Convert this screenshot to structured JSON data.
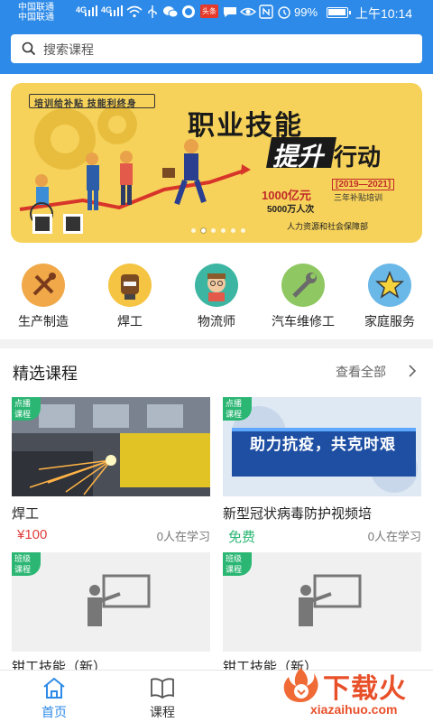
{
  "status_bar": {
    "carrier1": "中国联通",
    "carrier2": "中国联通",
    "net1": "4G",
    "net2": "4G",
    "notif_badge": "头条",
    "battery": "99%",
    "time": "上午10:14",
    "battery_level": 0.99
  },
  "search": {
    "placeholder": "搜索课程",
    "icon": "search-icon"
  },
  "banner": {
    "tag": "培训给补贴  技能利终身",
    "title1": "职业技能",
    "title2a": "提升",
    "title2b": "行动",
    "years": "[2019—2021]",
    "subtitle": "三年补贴培训",
    "amount": "1000亿元",
    "people": "5000万人次",
    "ministry": "人力资源和社会保障部",
    "slides": 6,
    "active_slide": 1
  },
  "categories": [
    {
      "label": "生产制造",
      "icon": "tools-icon",
      "color": "#f0a848"
    },
    {
      "label": "焊工",
      "icon": "welder-icon",
      "color": "#f5c443"
    },
    {
      "label": "物流师",
      "icon": "logistician-icon",
      "color": "#3cb6a2"
    },
    {
      "label": "汽车维修工",
      "icon": "wrench-icon",
      "color": "#8fc862"
    },
    {
      "label": "家庭服务",
      "icon": "star-icon",
      "color": "#6ab8e8"
    }
  ],
  "section": {
    "title": "精选课程",
    "see_all": "查看全部"
  },
  "courses": [
    {
      "badge": "点播课程",
      "title": "焊工",
      "price": "¥100",
      "learners": "0人在学习"
    },
    {
      "badge": "点播课程",
      "title": "新型冠状病毒防护视频培",
      "price": "免费",
      "learners": "0人在学习",
      "image_text": "助力抗疫，共克时艰"
    },
    {
      "badge": "班级课程",
      "title": "钳工技能（新）"
    },
    {
      "badge": "班级课程",
      "title": "钳工技能（新）"
    }
  ],
  "nav": [
    {
      "label": "首页",
      "icon": "home-icon",
      "active": true
    },
    {
      "label": "课程",
      "icon": "book-icon",
      "active": false
    }
  ],
  "watermark": {
    "text": "下载火",
    "url": "xiazaihuo.com"
  },
  "colors": {
    "primary": "#2d8ae8",
    "price_red": "#e23c3c",
    "free_green": "#2bb673"
  }
}
